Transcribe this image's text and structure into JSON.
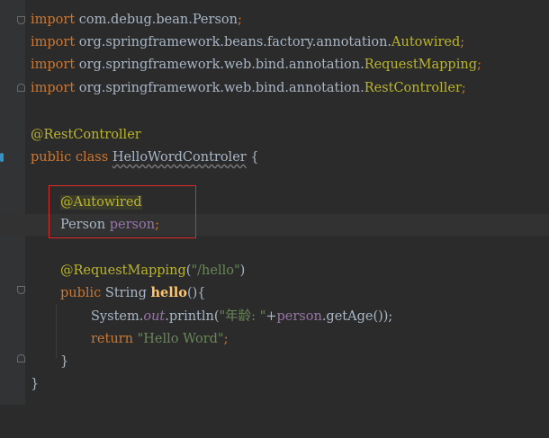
{
  "imports": [
    {
      "keyword": "import",
      "pkg": "com.debug.bean.",
      "cls": "Person",
      "semi": ";"
    },
    {
      "keyword": "import",
      "pkg": "org.springframework.beans.factory.annotation.",
      "cls": "Autowired",
      "semi": ";"
    },
    {
      "keyword": "import",
      "pkg": "org.springframework.web.bind.annotation.",
      "cls": "RequestMapping",
      "semi": ";"
    },
    {
      "keyword": "import",
      "pkg": "org.springframework.web.bind.annotation.",
      "cls": "RestController",
      "semi": ";"
    }
  ],
  "class_annotation": "@RestController",
  "class_decl": {
    "mods": "public class",
    "name": "HelloWordControler",
    "brace": " {"
  },
  "field_annotation": "@Autowired",
  "field": {
    "type": "Person",
    "name": "person",
    "semi": ";"
  },
  "method_annotation": {
    "name": "@RequestMapping",
    "open": "(",
    "value": "\"/hello\"",
    "close": ")"
  },
  "method_decl": {
    "mods": "public",
    "type": " String ",
    "name": "hello",
    "rest": "(){"
  },
  "println": {
    "recv": "System.",
    "field": "out",
    "call": ".println(",
    "str": "\"年龄: \"",
    "plus": "+",
    "obj": "person",
    "rest": ".getAge());"
  },
  "return_stmt": {
    "kw": "return",
    "str": "\"Hello Word\"",
    "semi": ";"
  },
  "close_method": "}",
  "close_class": "}",
  "colors": {
    "background": "#2b2b2b",
    "keyword": "#cc7832",
    "annotation": "#bbb529",
    "string": "#6a8759",
    "field": "#9876aa",
    "method": "#ffc66d",
    "text": "#a9b7c6",
    "highlight_box": "#e02a2a"
  }
}
